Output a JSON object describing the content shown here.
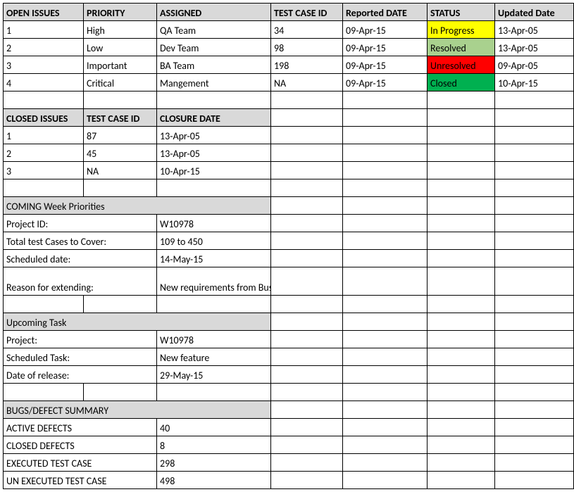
{
  "open_issues": {
    "headers": [
      "OPEN ISSUES",
      "PRIORITY",
      "ASSIGNED",
      "TEST CASE ID",
      "Reported DATE",
      "STATUS",
      "Updated Date"
    ],
    "rows": [
      {
        "n": "1",
        "priority": "High",
        "assigned": "QA Team",
        "tcid": "34",
        "rdate": "09-Apr-15",
        "status": "In Progress",
        "status_cls": "status-yellow",
        "udate": "13-Apr-05"
      },
      {
        "n": "2",
        "priority": "Low",
        "assigned": "Dev Team",
        "tcid": "98",
        "rdate": "09-Apr-15",
        "status": "Resolved",
        "status_cls": "status-lgreen",
        "udate": "13-Apr-05"
      },
      {
        "n": "3",
        "priority": "Important",
        "assigned": "BA Team",
        "tcid": "198",
        "rdate": "09-Apr-15",
        "status": "Unresolved",
        "status_cls": "status-red",
        "udate": "09-Apr-05"
      },
      {
        "n": "4",
        "priority": "Critical",
        "assigned": "Mangement",
        "tcid": "NA",
        "tcid_align": "left",
        "rdate": "09-Apr-15",
        "status": "Closed",
        "status_cls": "status-green",
        "udate": "10-Apr-15"
      }
    ]
  },
  "closed_issues": {
    "headers": [
      "CLOSED ISSUES",
      "TEST CASE ID",
      "CLOSURE DATE"
    ],
    "rows": [
      {
        "n": "1",
        "tcid": "87",
        "cdate": "13-Apr-05"
      },
      {
        "n": "2",
        "tcid": "45",
        "cdate": "13-Apr-05"
      },
      {
        "n": "3",
        "tcid": "NA",
        "tcid_align": "left",
        "cdate": "10-Apr-15"
      }
    ]
  },
  "coming_week": {
    "title": "COMING Week Priorities",
    "rows": [
      {
        "label": "Project ID:",
        "value": "W10978"
      },
      {
        "label": "Total test Cases to Cover:",
        "value": "109 to 450"
      },
      {
        "label": "Scheduled date:",
        "value": "14-May-15",
        "align": "right"
      },
      {
        "label": "Reason for extending:",
        "value": "New requirements from Business",
        "wrap": true
      }
    ]
  },
  "upcoming_task": {
    "title": "Upcoming Task",
    "rows": [
      {
        "label": "Project:",
        "value": "W10978"
      },
      {
        "label": "Scheduled Task:",
        "value": "New feature"
      },
      {
        "label": "Date of release:",
        "value": "29-May-15",
        "align": "right"
      }
    ]
  },
  "bugs_summary": {
    "title": "BUGS/DEFECT SUMMARY",
    "rows": [
      {
        "label": "ACTIVE DEFECTS",
        "value": "40"
      },
      {
        "label": "CLOSED DEFECTS",
        "value": "8"
      },
      {
        "label": "EXECUTED TEST CASE",
        "value": "298"
      },
      {
        "label": "UN EXECUTED TEST CASE",
        "value": "498"
      }
    ]
  }
}
